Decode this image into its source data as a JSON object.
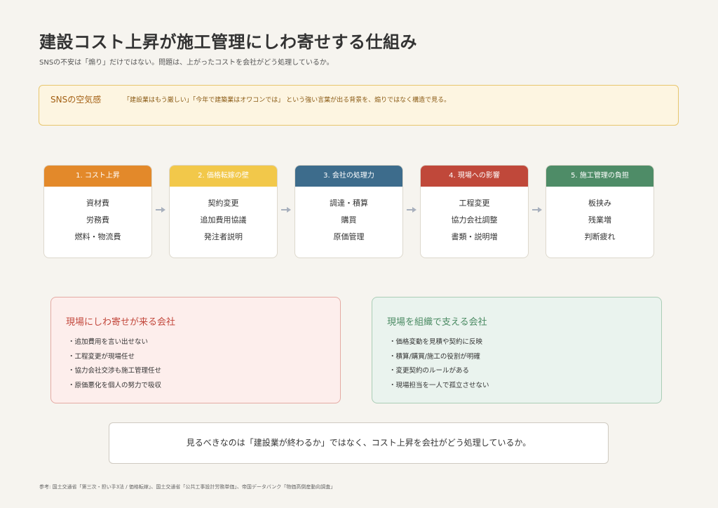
{
  "title": "建設コスト上昇が施工管理にしわ寄せする仕組み",
  "subtitle": "SNSの不安は「煽り」だけではない。問題は、上がったコストを会社がどう処理しているか。",
  "sns": {
    "label": "SNSの空気感",
    "text": "「建設業はもう厳しい」「今年で建築業はオワコンでは」 という強い言葉が出る背景を、煽りではなく構造で見る。"
  },
  "flow": [
    {
      "header": "1. コスト上昇",
      "color": "#e3892a",
      "items": [
        "資材費",
        "労務費",
        "燃料・物流費"
      ]
    },
    {
      "header": "2. 価格転嫁の壁",
      "color": "#f2c84a",
      "items": [
        "契約変更",
        "追加費用協議",
        "発注者説明"
      ]
    },
    {
      "header": "3. 会社の処理力",
      "color": "#3d6c8c",
      "items": [
        "調達・積算",
        "購買",
        "原価管理"
      ]
    },
    {
      "header": "4. 現場への影響",
      "color": "#c0483a",
      "items": [
        "工程変更",
        "協力会社調整",
        "書類・説明増"
      ]
    },
    {
      "header": "5. 施工管理の負担",
      "color": "#4e8c67",
      "items": [
        "板挟み",
        "残業増",
        "判断疲れ"
      ]
    }
  ],
  "panels": {
    "red": {
      "title": "現場にしわ寄せが来る会社",
      "items": [
        "・追加費用を言い出せない",
        "・工程変更が現場任せ",
        "・協力会社交渉も施工管理任せ",
        "・原価悪化を個人の努力で吸収"
      ]
    },
    "green": {
      "title": "現場を組織で支える会社",
      "items": [
        "・価格変動を見積や契約に反映",
        "・積算/購買/施工の役割が明確",
        "・変更契約のルールがある",
        "・現場担当を一人で孤立させない"
      ]
    }
  },
  "conclusion": "見るべきなのは「建設業が終わるか」ではなく、コスト上昇を会社がどう処理しているか。",
  "footnote": "参考: 国土交通省「第三次・担い手3法 / 価格転嫁」、国土交通省「公共工事設計労務単価」、帝国データバンク「物価高倒産動向調査」"
}
